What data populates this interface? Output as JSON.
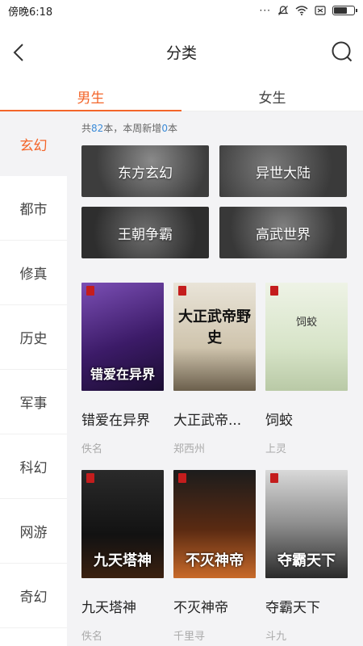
{
  "status_bar": {
    "time": "傍晚6:18"
  },
  "header": {
    "title": "分类"
  },
  "tabs": [
    {
      "label": "男生"
    },
    {
      "label": "女生"
    }
  ],
  "sidebar": {
    "items": [
      "玄幻",
      "都市",
      "修真",
      "历史",
      "军事",
      "科幻",
      "网游",
      "奇幻"
    ]
  },
  "summary": {
    "prefix": "共",
    "total": "82",
    "mid": "本，本周新增",
    "new": "0",
    "suffix": "本"
  },
  "subcategories": [
    "东方玄幻",
    "异世大陆",
    "王朝争霸",
    "高武世界"
  ],
  "books": [
    {
      "title": "错爱在异界",
      "author": "佚名",
      "cover_text": "错爱在异界"
    },
    {
      "title": "大正武帝...",
      "author": "郑西州",
      "cover_text": "大正武帝野史"
    },
    {
      "title": "饲蛟",
      "author": "上灵",
      "cover_text": "饲蛟"
    },
    {
      "title": "九天塔神",
      "author": "佚名",
      "cover_text": "九天塔神"
    },
    {
      "title": "不灭神帝",
      "author": "千里寻",
      "cover_text": "不灭神帝"
    },
    {
      "title": "夺霸天下",
      "author": "斗九",
      "cover_text": "夺霸天下"
    }
  ],
  "colors": {
    "accent": "#f3652a",
    "number": "#3b8bd8"
  },
  "icons": {
    "back": "back-arrow-icon",
    "search": "search-icon"
  }
}
